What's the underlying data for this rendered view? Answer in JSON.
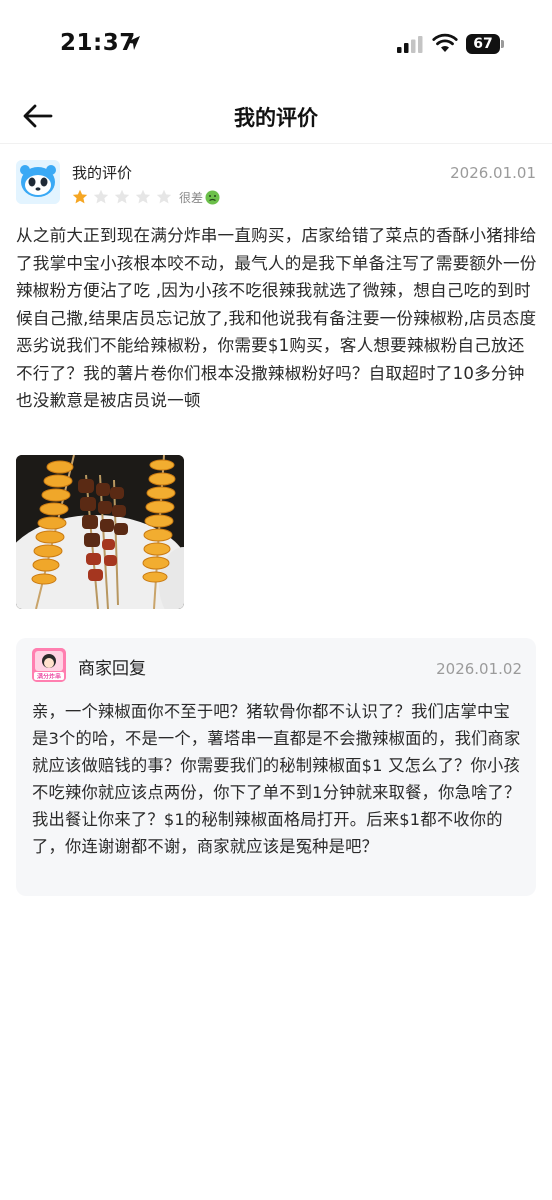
{
  "status_bar": {
    "time": "21:37",
    "battery_level": "67"
  },
  "nav": {
    "title": "我的评价"
  },
  "review": {
    "reviewer_name": "我的评价",
    "date": "2026.01.01",
    "rating": {
      "value": 1,
      "max": 5,
      "label": "很差"
    },
    "text": "从之前大正到现在满分炸串一直购买，店家给错了菜点的香酥小猪排给了我掌中宝小孩根本咬不动，最气人的是我下单备注写了需要额外一份辣椒粉方便沾了吃 ,因为小孩不吃很辣我就选了微辣，想自己吃的到时候自己撒,结果店员忘记放了,我和他说我有备注要一份辣椒粉,店员态度恶劣说我们不能给辣椒粉，你需要$1购买，客人想要辣椒粉自己放还不行了？我的薯片卷你们根本没撒辣椒粉好吗？自取超时了10多分钟也没歉意是被店员说一顿"
  },
  "reply": {
    "title": "商家回复",
    "date": "2026.01.02",
    "logo_text": "满分炸串",
    "text": "亲，一个辣椒面你不至于吧？猪软骨你都不认识了？我们店掌中宝是3个的哈，不是一个，薯塔串一直都是不会撒辣椒面的，我们商家就应该做赔钱的事？你需要我们的秘制辣椒面$1 又怎么了？你小孩不吃辣你就应该点两份，你下了单不到1分钟就来取餐，你急啥了？我出餐让你来了？$1的秘制辣椒面格局打开。后来$1都不收你的了，你连谢谢都不谢，商家就应该是冤种是吧？"
  },
  "colors": {
    "star_active": "#f5a623",
    "star_inactive": "#e6e6e6",
    "reply_bg": "#f6f7f9",
    "secondary_text": "#9b9b9b"
  },
  "icons": [
    "back-arrow-icon",
    "location-arrow-icon",
    "signal-icon",
    "wifi-icon",
    "battery-icon",
    "panda-avatar-icon",
    "star-icon",
    "sick-face-icon",
    "merchant-logo"
  ]
}
